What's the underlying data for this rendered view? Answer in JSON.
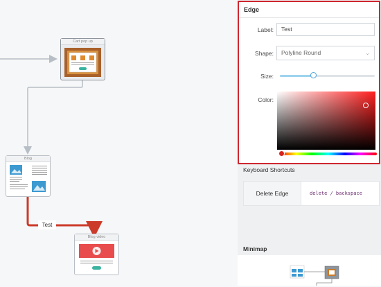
{
  "canvas": {
    "nodes": [
      {
        "id": "cart",
        "title": "Cart pop up"
      },
      {
        "id": "blog",
        "title": "Blog"
      },
      {
        "id": "video",
        "title": "Blog video"
      }
    ],
    "edge_label": "Test",
    "colors": {
      "edge_selected": "#cc3a2a",
      "edge_default": "#b7bec6",
      "node_orange": "#c87a2a",
      "node_blue": "#3d9ad1",
      "node_red": "#e84c4c",
      "node_green": "#3ab3a1"
    }
  },
  "edge_panel": {
    "title": "Edge",
    "label_field": {
      "label": "Label:",
      "value": "Test"
    },
    "shape_field": {
      "label": "Shape:",
      "value": "Polyline Round"
    },
    "size_field": {
      "label": "Size:",
      "value": 0.35
    },
    "color_field": {
      "label": "Color:",
      "hue_color": "#ff1e1e",
      "selected_color": "#cc3a2a"
    },
    "border_color": "#d0272f"
  },
  "keyboard": {
    "title": "Keyboard Shortcuts",
    "shortcut_name": "Delete Edge",
    "keys": "delete / backspace"
  },
  "minimap": {
    "title": "Minimap"
  }
}
